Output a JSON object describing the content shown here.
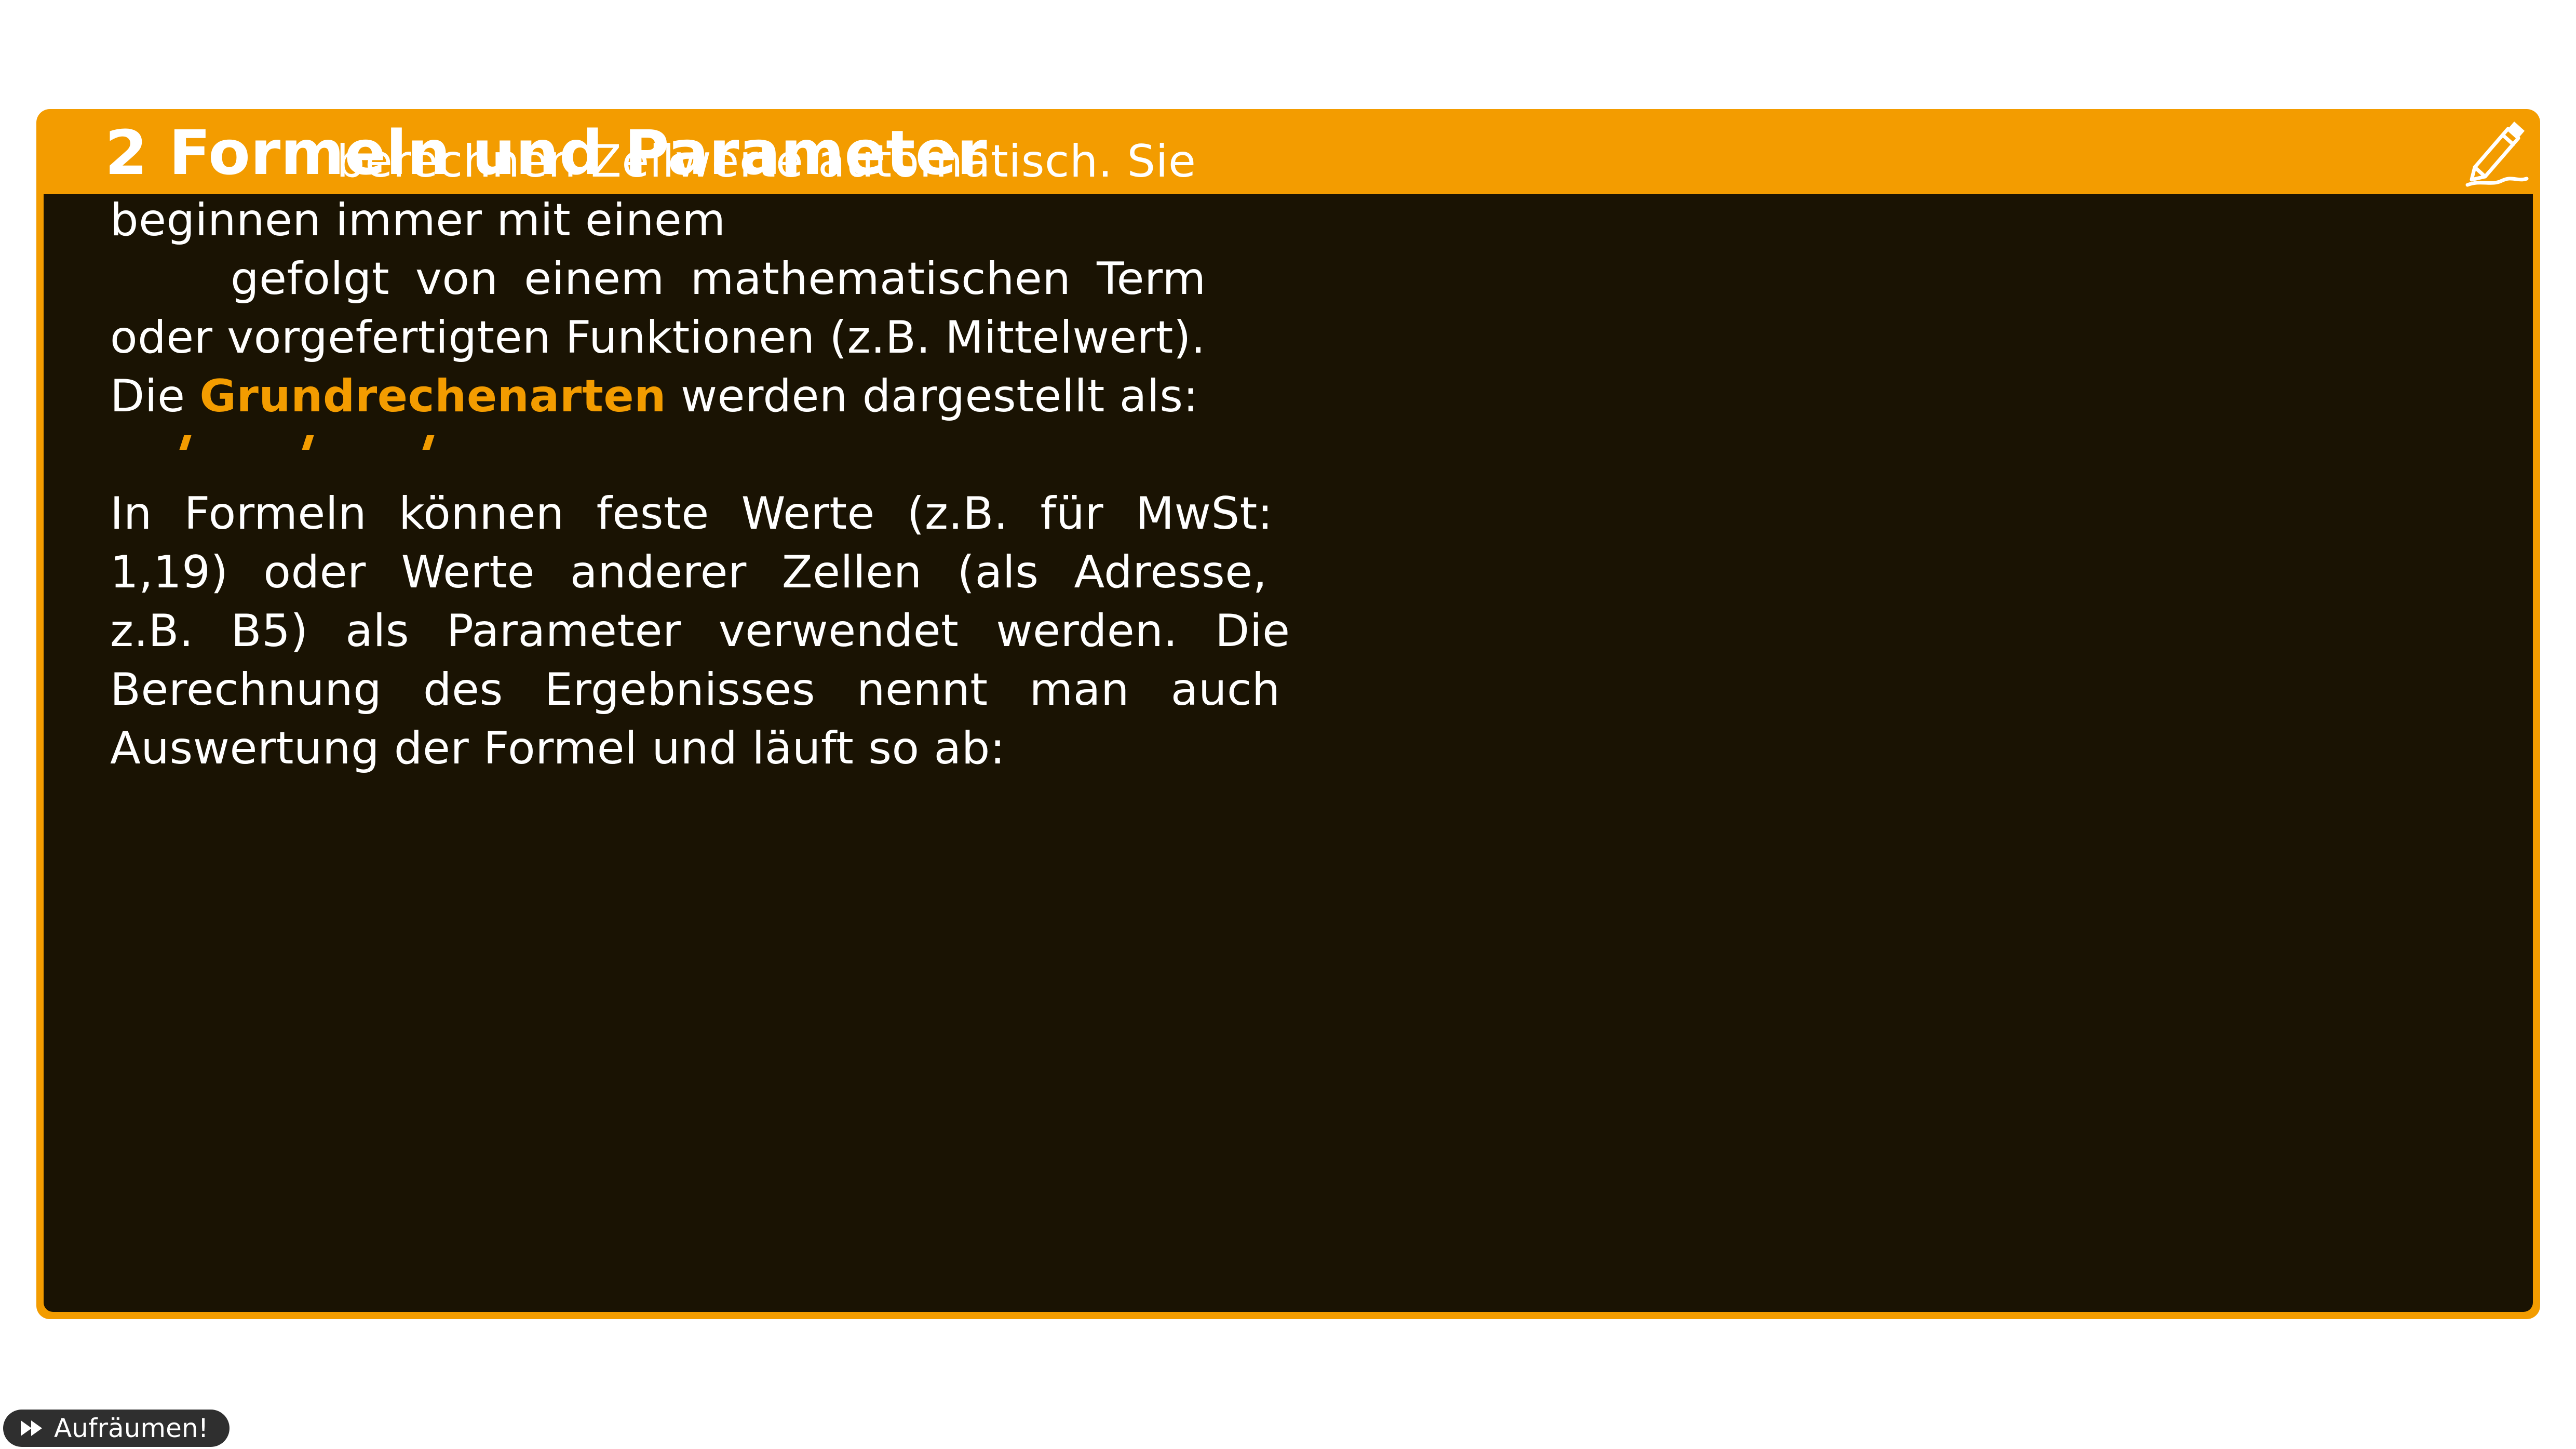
{
  "panel": {
    "title": "2 Formeln und Parameter",
    "accent_color": "#f39c00",
    "body_color": "#1a1303",
    "edit_icon": "pencil-icon"
  },
  "content": {
    "line1": "berechnen Zellwerte automatisch. Sie",
    "line2": "beginnen immer mit einem",
    "line3": "gefolgt von einem mathematischen Term",
    "line4": "oder vorgefertigten Funktionen (z.B. Mittelwert).",
    "line5_pre": "Die",
    "line5_highlight": "Grundrechenarten",
    "line5_post": "werden dargestellt als:",
    "line7": "In Formeln können feste Werte (z.B. für MwSt:",
    "line8": "1,19) oder Werte anderer Zellen (als Adresse,",
    "line9": "z.B. B5) als Parameter verwendet werden. Die",
    "line10": "Berechnung des Ergebnisses nennt man auch",
    "line11": "Auswertung der Formel und läuft so ab:"
  },
  "footer": {
    "cleanup_label": "Aufräumen!",
    "cleanup_icon": "fast-forward-icon"
  }
}
